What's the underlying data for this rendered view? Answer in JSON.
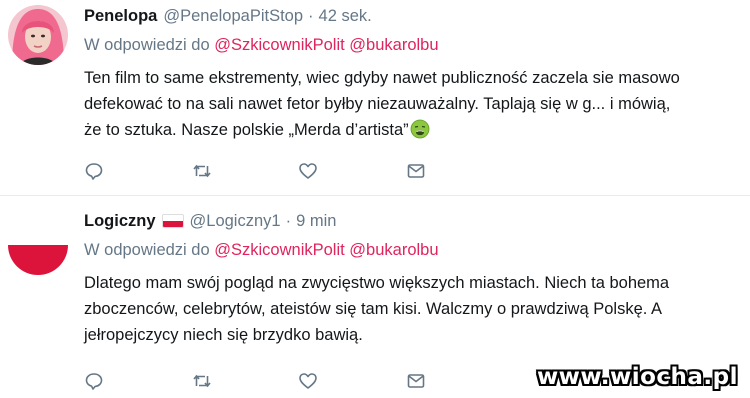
{
  "tweets": [
    {
      "display_name": "Penelopa",
      "handle": "@PenelopaPitStop",
      "separator": "·",
      "time": "42 sek.",
      "reply_prefix": "W odpowiedzi do",
      "reply_mentions": [
        "@SzkicownikPolit",
        "@bukarolbu"
      ],
      "text_lines": [
        "Ten film to same ekstrementy, wiec gdyby nawet publiczność zaczela sie masowo",
        "defekować to na sali nawet fetor byłby niezauważalny. Taplają się w g... i mówią,",
        "że to sztuka. Nasze polskie „Merda d’artista”"
      ],
      "emoji": "nauseated-face",
      "avatar": "pink-hair-profile"
    },
    {
      "display_name": "Logiczny",
      "flag": "poland-flag",
      "handle": "@Logiczny1",
      "separator": "·",
      "time": "9 min",
      "reply_prefix": "W odpowiedzi do",
      "reply_mentions": [
        "@SzkicownikPolit",
        "@bukarolbu"
      ],
      "text_lines": [
        "Dlatego mam swój pogląd na zwycięstwo większych miastach.  Niech ta bohema",
        "zboczenców, celebrytów, ateistów się tam kisi. Walczmy o prawdziwą Polskę. A",
        "jełropejczycy niech się brzydko bawią."
      ],
      "avatar": "poland-flag-avatar"
    }
  ],
  "actions": [
    "reply-icon",
    "retweet-icon",
    "like-icon",
    "message-icon"
  ],
  "colors": {
    "mention": "#e0245e",
    "secondary": "#657786",
    "action_icon": "#657786",
    "divider": "#e6ecf0"
  },
  "watermark": "www.wiocha.pl"
}
